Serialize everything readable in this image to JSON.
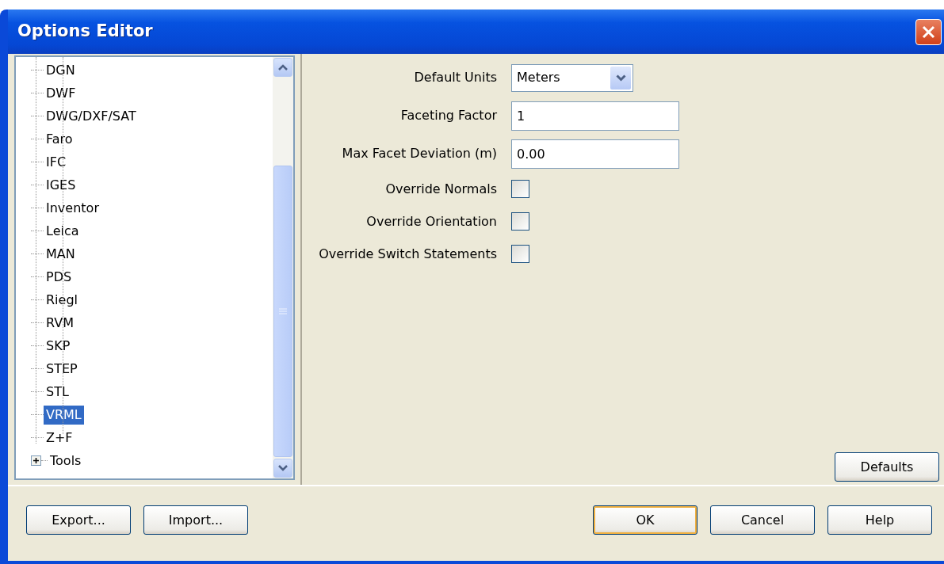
{
  "window": {
    "title": "Options Editor"
  },
  "tree": {
    "items": [
      {
        "children": [
          {
            "label": "DGN",
            "selected": false
          },
          {
            "label": "DWF",
            "selected": false
          },
          {
            "label": "DWG/DXF/SAT",
            "selected": false
          },
          {
            "label": "Faro",
            "selected": false
          },
          {
            "label": "IFC",
            "selected": false
          },
          {
            "label": "IGES",
            "selected": false
          },
          {
            "label": "Inventor",
            "selected": false
          },
          {
            "label": "Leica",
            "selected": false
          },
          {
            "label": "MAN",
            "selected": false
          },
          {
            "label": "PDS",
            "selected": false
          },
          {
            "label": "Riegl",
            "selected": false
          },
          {
            "label": "RVM",
            "selected": false
          },
          {
            "label": "SKP",
            "selected": false
          },
          {
            "label": "STEP",
            "selected": false
          },
          {
            "label": "STL",
            "selected": false
          },
          {
            "label": "VRML",
            "selected": true
          },
          {
            "label": "Z+F",
            "selected": false
          }
        ]
      },
      {
        "label": "Tools",
        "selected": false,
        "expanded": false
      }
    ]
  },
  "form": [
    {
      "kind": "select",
      "label": "Default Units",
      "value": "Meters"
    },
    {
      "kind": "text",
      "label": "Faceting Factor",
      "value": "1"
    },
    {
      "kind": "text",
      "label": "Max Facet Deviation (m)",
      "value": "0.00"
    },
    {
      "kind": "checkbox",
      "label": "Override Normals",
      "checked": false
    },
    {
      "kind": "checkbox",
      "label": "Override Orientation",
      "checked": false
    },
    {
      "kind": "checkbox",
      "label": "Override Switch Statements",
      "checked": false
    }
  ],
  "defaults_button": "Defaults",
  "footer_left": [
    "Export...",
    "Import..."
  ],
  "footer_right": [
    {
      "label": "OK",
      "default": true
    },
    {
      "label": "Cancel",
      "default": false
    },
    {
      "label": "Help",
      "default": false
    }
  ]
}
